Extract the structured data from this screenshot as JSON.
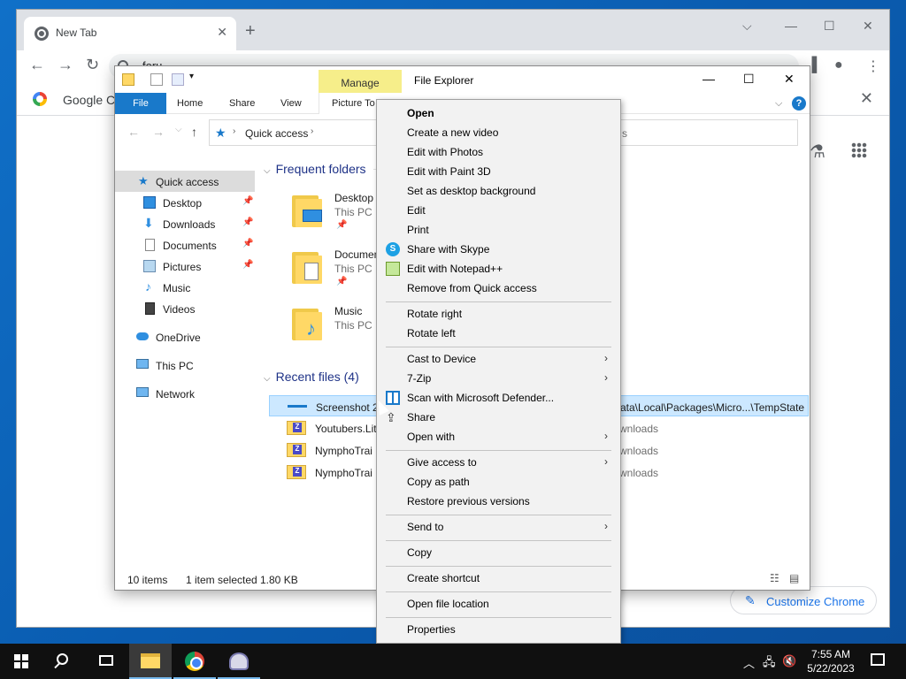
{
  "chrome": {
    "tab_title": "New Tab",
    "omnibox_text": "foru",
    "bookmark_google": "Google Ch",
    "customize_label": "Customize Chrome"
  },
  "explorer": {
    "title": "File Explorer",
    "manage_tab": "Manage",
    "ribbon_tabs": [
      "File",
      "Home",
      "Share",
      "View",
      "Picture To"
    ],
    "address": "Quick access",
    "search_placeholder": "s",
    "nav": [
      {
        "label": "Quick access",
        "icon": "star-icon"
      },
      {
        "label": "Desktop",
        "icon": "desktop-icon"
      },
      {
        "label": "Downloads",
        "icon": "download-icon"
      },
      {
        "label": "Documents",
        "icon": "documents-icon"
      },
      {
        "label": "Pictures",
        "icon": "pictures-icon"
      },
      {
        "label": "Music",
        "icon": "music-icon"
      },
      {
        "label": "Videos",
        "icon": "videos-icon"
      },
      {
        "label": "OneDrive",
        "icon": "cloud-icon"
      },
      {
        "label": "This PC",
        "icon": "computer-icon"
      },
      {
        "label": "Network",
        "icon": "network-icon"
      }
    ],
    "frequent_header": "Frequent folders",
    "frequent": [
      {
        "name": "Desktop",
        "sub": "This PC"
      },
      {
        "name": "Documen",
        "sub": "This PC"
      },
      {
        "name": "Music",
        "sub": "This PC"
      }
    ],
    "recent_header": "Recent files (4)",
    "recent": [
      {
        "name": "Screenshot 2",
        "path": "ata\\Local\\Packages\\Micro...\\TempState"
      },
      {
        "name": "Youtubers.Lit",
        "path": "wnloads"
      },
      {
        "name": "NymphoTrai",
        "path": "wnloads"
      },
      {
        "name": "NymphoTrai",
        "path": "wnloads"
      }
    ],
    "status_items": "10 items",
    "status_selected": "1 item selected",
    "status_size": "1.80 KB"
  },
  "context_menu": {
    "group1": [
      "Open",
      "Create a new video",
      "Edit with Photos",
      "Edit with Paint 3D",
      "Set as desktop background",
      "Edit",
      "Print",
      "Share with Skype",
      "Edit with Notepad++",
      "Remove from Quick access"
    ],
    "group2": [
      "Rotate right",
      "Rotate left"
    ],
    "group3": [
      "Cast to Device",
      "7-Zip",
      "Scan with Microsoft Defender...",
      "Share",
      "Open with"
    ],
    "group4": [
      "Give access to",
      "Copy as path",
      "Restore previous versions"
    ],
    "group5": [
      "Send to"
    ],
    "group6": [
      "Copy"
    ],
    "group7": [
      "Create shortcut"
    ],
    "group8": [
      "Open file location"
    ],
    "group9": [
      "Properties"
    ]
  },
  "taskbar": {
    "time": "7:55 AM",
    "date": "5/22/2023"
  }
}
